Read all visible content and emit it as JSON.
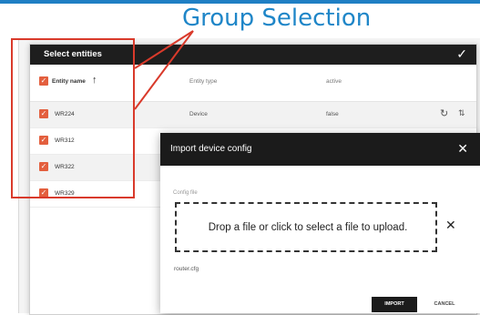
{
  "callout": {
    "title": "Group Selection"
  },
  "select_dialog": {
    "title": "Select entities",
    "columns": {
      "name": "Entity name",
      "type": "Entity type",
      "active": "active"
    },
    "rows": [
      {
        "name": "WR224",
        "type": "Device",
        "active": "false"
      },
      {
        "name": "WR312",
        "type": "",
        "active": ""
      },
      {
        "name": "WR322",
        "type": "",
        "active": ""
      },
      {
        "name": "WR329",
        "type": "",
        "active": ""
      }
    ]
  },
  "import_dialog": {
    "title": "Import device config",
    "field_label": "Config file",
    "dropzone_text": "Drop a file or click to select a file to upload.",
    "file_name": "router.cfg",
    "import_label": "IMPORT",
    "cancel_label": "CANCEL"
  },
  "colors": {
    "accent": "#1f86c8",
    "annotation": "#d93a2b",
    "checkbox": "#e35f3e",
    "dark": "#1b1b1b"
  },
  "icons": [
    "check-icon",
    "sort-up-icon",
    "refresh-icon",
    "sort-icon",
    "close-icon"
  ]
}
